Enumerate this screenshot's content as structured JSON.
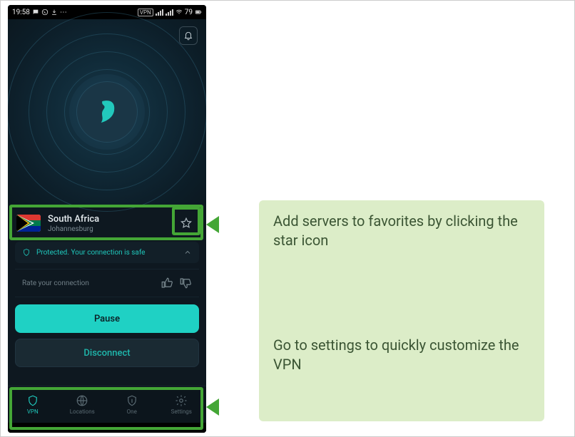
{
  "statusbar": {
    "time": "19:58",
    "vpn_badge": "VPN",
    "battery_pct": "79"
  },
  "server": {
    "country": "South Africa",
    "city": "Johannesburg"
  },
  "status": {
    "text": "Protected. Your connection is safe"
  },
  "rate": {
    "label": "Rate your connection"
  },
  "buttons": {
    "pause": "Pause",
    "disconnect": "Disconnect"
  },
  "nav": {
    "vpn": "VPN",
    "locations": "Locations",
    "one": "One",
    "settings": "Settings"
  },
  "callouts": {
    "favorites": "Add servers to favorites by clicking the star icon",
    "settings": "Go to settings to quickly customize the VPN"
  },
  "colors": {
    "accent_green": "#44a636",
    "teal": "#1fc7bb"
  }
}
